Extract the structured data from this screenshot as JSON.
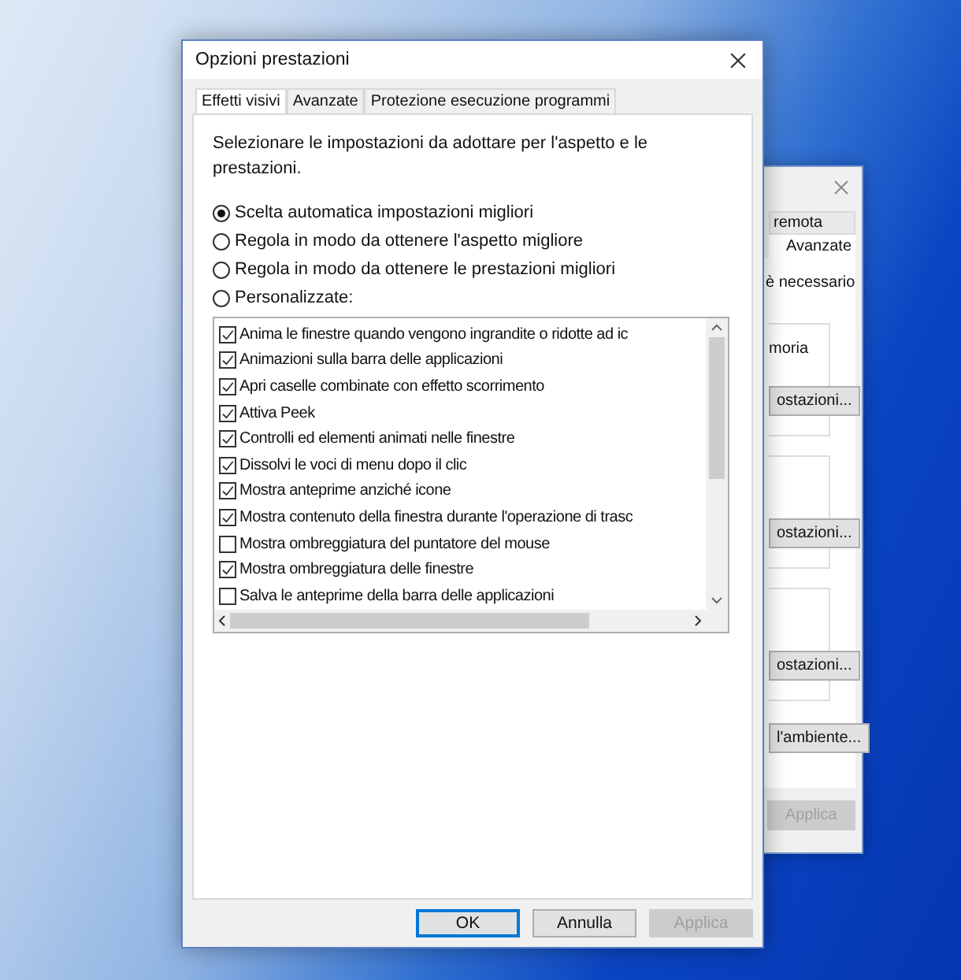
{
  "back_window": {
    "tabs": [
      {
        "label": "remota",
        "selected": false
      },
      {
        "label": "Avanzate",
        "selected": true
      }
    ],
    "note": "è necessario",
    "groups": [
      {
        "text": "moria",
        "button": "ostazioni..."
      },
      {
        "button": "ostazioni..."
      },
      {
        "button": "ostazioni..."
      }
    ],
    "env_button": "l'ambiente...",
    "buttons": [
      {
        "label": "Applica",
        "disabled": true
      }
    ]
  },
  "dialog": {
    "title": "Opzioni prestazioni",
    "tabs": [
      {
        "label": "Effetti visivi",
        "selected": true
      },
      {
        "label": "Avanzate",
        "selected": false
      },
      {
        "label": "Protezione esecuzione programmi",
        "selected": false
      }
    ],
    "intro": "Selezionare le impostazioni da adottare per l'aspetto e le prestazioni.",
    "options": [
      {
        "label": "Scelta automatica impostazioni migliori",
        "selected": true
      },
      {
        "label": "Regola in modo da ottenere l'aspetto migliore",
        "selected": false
      },
      {
        "label": "Regola in modo da ottenere le prestazioni migliori",
        "selected": false
      },
      {
        "label": "Personalizzate:",
        "selected": false
      }
    ],
    "effects": [
      {
        "label": "Anima le finestre quando vengono ingrandite o ridotte ad ic",
        "checked": true
      },
      {
        "label": "Animazioni sulla barra delle applicazioni",
        "checked": true
      },
      {
        "label": "Apri caselle combinate con effetto scorrimento",
        "checked": true
      },
      {
        "label": "Attiva Peek",
        "checked": true
      },
      {
        "label": "Controlli ed elementi animati nelle finestre",
        "checked": true
      },
      {
        "label": "Dissolvi le voci di menu dopo il clic",
        "checked": true
      },
      {
        "label": "Mostra anteprime anziché icone",
        "checked": true
      },
      {
        "label": "Mostra contenuto della finestra durante l'operazione di trasc",
        "checked": true
      },
      {
        "label": "Mostra ombreggiatura del puntatore del mouse",
        "checked": false
      },
      {
        "label": "Mostra ombreggiatura delle finestre",
        "checked": true
      },
      {
        "label": "Salva le anteprime della barra delle applicazioni",
        "checked": false
      }
    ],
    "buttons": [
      {
        "label": "OK",
        "default": true,
        "disabled": false
      },
      {
        "label": "Annulla",
        "default": false,
        "disabled": false
      },
      {
        "label": "Applica",
        "default": false,
        "disabled": true
      }
    ]
  }
}
